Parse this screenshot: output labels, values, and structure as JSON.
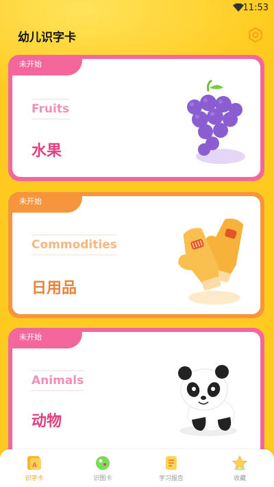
{
  "status_bar": {
    "time": "11:53"
  },
  "header": {
    "title": "幼儿识字卡"
  },
  "cards": [
    {
      "status": "未开始",
      "english": "Fruits",
      "chinese": "水果",
      "illustration": "grapes-illustration",
      "frame_color": "#F4679C",
      "tab_color": "#F4679C",
      "text_color": "#E0407F",
      "english_color": "#F28FB7"
    },
    {
      "status": "未开始",
      "english": "Commodities",
      "chinese": "日用品",
      "illustration": "mittens-illustration",
      "frame_color": "#F6953B",
      "tab_color": "#F6953B",
      "text_color": "#E9833A",
      "english_color": "#F8B67E"
    },
    {
      "status": "未开始",
      "english": "Animals",
      "chinese": "动物",
      "illustration": "panda-illustration",
      "frame_color": "#F4679C",
      "tab_color": "#F4679C",
      "text_color": "#E0407F",
      "english_color": "#F28FB7"
    }
  ],
  "nav": [
    {
      "label": "识字卡",
      "icon": "flashcard-icon",
      "active": true
    },
    {
      "label": "识图卡",
      "icon": "picture-card-icon",
      "active": false
    },
    {
      "label": "学习报告",
      "icon": "report-icon",
      "active": false
    },
    {
      "label": "收藏",
      "icon": "star-icon",
      "active": false
    }
  ],
  "colors": {
    "background": "#FFCB1F",
    "accent": "#F0A020"
  }
}
